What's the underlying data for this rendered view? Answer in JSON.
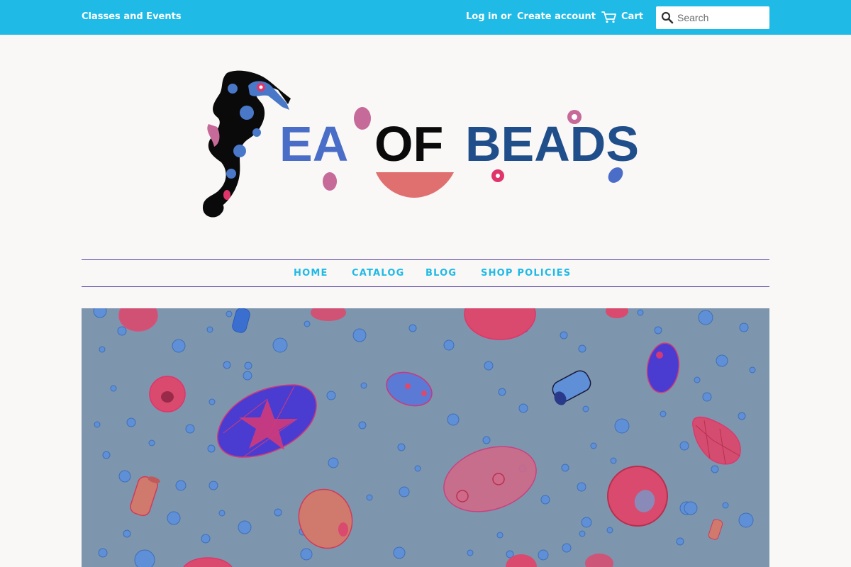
{
  "topbar": {
    "classes_link": "Classes and Events",
    "login_link": "Log in",
    "or_text": "or",
    "create_account_link": "Create account",
    "cart_label": "Cart",
    "search_placeholder": "Search",
    "background_color": "#1fbae6"
  },
  "logo": {
    "text": "SEA OF BEADS"
  },
  "nav": {
    "items": [
      {
        "label": "HOME"
      },
      {
        "label": "CATALOG"
      },
      {
        "label": "BLOG"
      },
      {
        "label": "SHOP POLICIES"
      }
    ],
    "text_color": "#1fbae6",
    "border_color": "#5a48a8"
  },
  "hero": {
    "background_color": "#7d96ae",
    "bead_colors": [
      "#e0356a",
      "#4a3cd0",
      "#4a7fd0",
      "#d06a6a",
      "#5f8fd6"
    ]
  },
  "icons": {
    "cart": "cart-icon",
    "search": "search-icon",
    "seahorse": "seahorse-icon"
  }
}
